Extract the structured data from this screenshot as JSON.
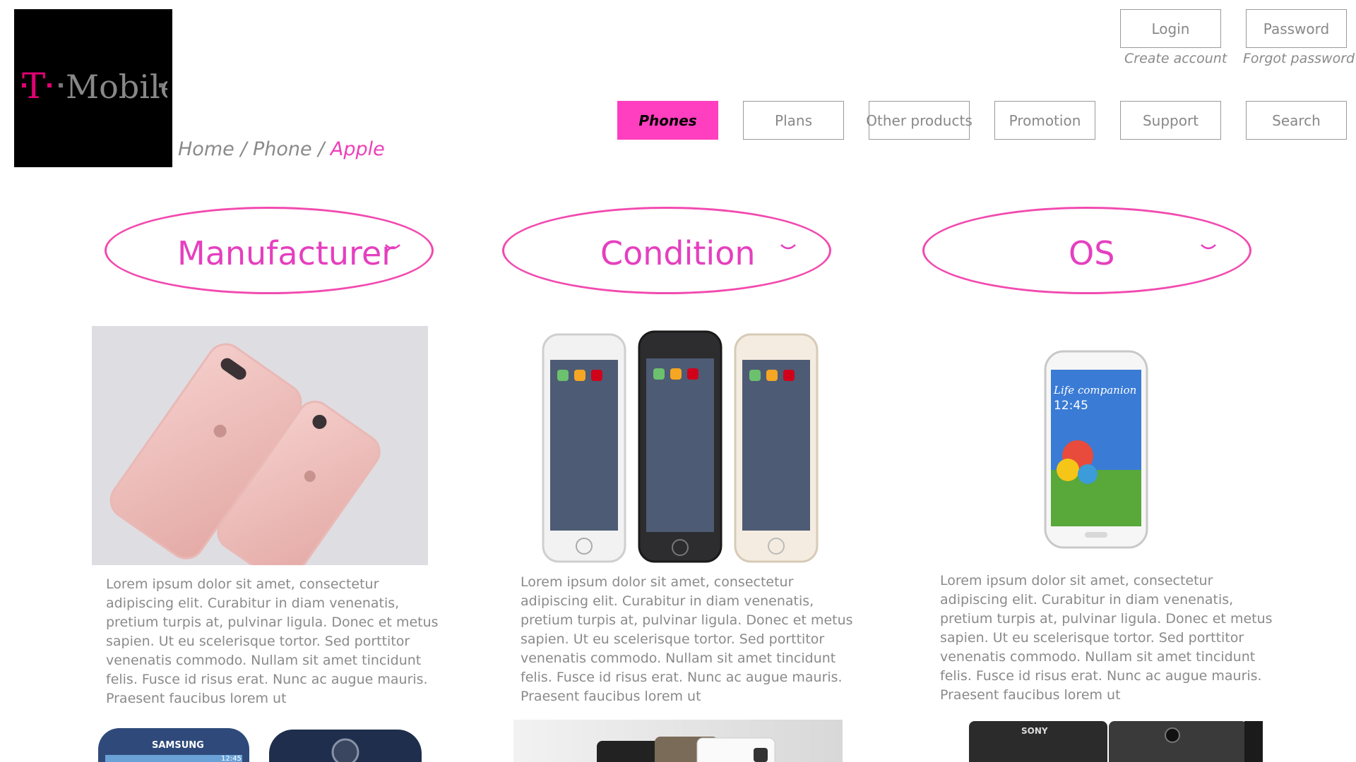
{
  "brand": {
    "logo_text": "T · · Mobile ·"
  },
  "breadcrumb": {
    "home": "Home",
    "sep1": " / ",
    "phone": "Phone",
    "sep2": " / ",
    "current": "Apple"
  },
  "auth": {
    "login_label": "Login",
    "password_label": "Password",
    "create_account": "Create account",
    "forgot_password": "Forgot password"
  },
  "nav": {
    "items": [
      {
        "label": "Phones",
        "active": true
      },
      {
        "label": "Plans",
        "active": false
      },
      {
        "label": "Other products",
        "active": false
      },
      {
        "label": "Promotion",
        "active": false
      },
      {
        "label": "Support",
        "active": false
      },
      {
        "label": "Search",
        "active": false
      }
    ]
  },
  "filters": [
    {
      "label": "Manufacturer"
    },
    {
      "label": "Condition"
    },
    {
      "label": "OS"
    }
  ],
  "products": [
    {
      "image_icon": "rose-gold-iphone-7-image",
      "description": "Lorem ipsum dolor sit amet, consectetur adipiscing elit. Curabitur in diam venenatis, pretium turpis at, pulvinar ligula. Donec et metus sapien. Ut eu scelerisque tortor. Sed porttitor venenatis commodo. Nullam sit amet tincidunt felis. Fusce id risus erat. Nunc ac augue mauris. Praesent faucibus lorem ut"
    },
    {
      "image_icon": "iphone-6-trio-image",
      "description": "Lorem ipsum dolor sit amet, consectetur adipiscing elit. Curabitur in diam venenatis, pretium turpis at, pulvinar ligula. Donec et metus sapien. Ut eu scelerisque tortor. Sed porttitor venenatis commodo. Nullam sit amet tincidunt felis. Fusce id risus erat. Nunc ac augue mauris. Praesent faucibus lorem ut"
    },
    {
      "image_icon": "samsung-galaxy-s4-image",
      "screen_text_1": "Life companion",
      "screen_text_2": "12:45",
      "description": "Lorem ipsum dolor sit amet, consectetur adipiscing elit. Curabitur in diam venenatis, pretium turpis at, pulvinar ligula. Donec et metus sapien. Ut eu scelerisque tortor. Sed porttitor venenatis commodo. Nullam sit amet tincidunt felis. Fusce id risus erat. Nunc ac augue mauris. Praesent faucibus lorem ut"
    },
    {
      "image_icon": "samsung-galaxy-image",
      "brand_text": "SAMSUNG",
      "screen_time": "12:45"
    },
    {
      "image_icon": "phones-group-image"
    },
    {
      "image_icon": "sony-xperia-image",
      "brand_text": "SONY"
    }
  ],
  "colors": {
    "accent": "#ff3fbf",
    "border": "#9a9a9a",
    "text": "#8a8a8a",
    "logo_magenta": "#e20074"
  }
}
